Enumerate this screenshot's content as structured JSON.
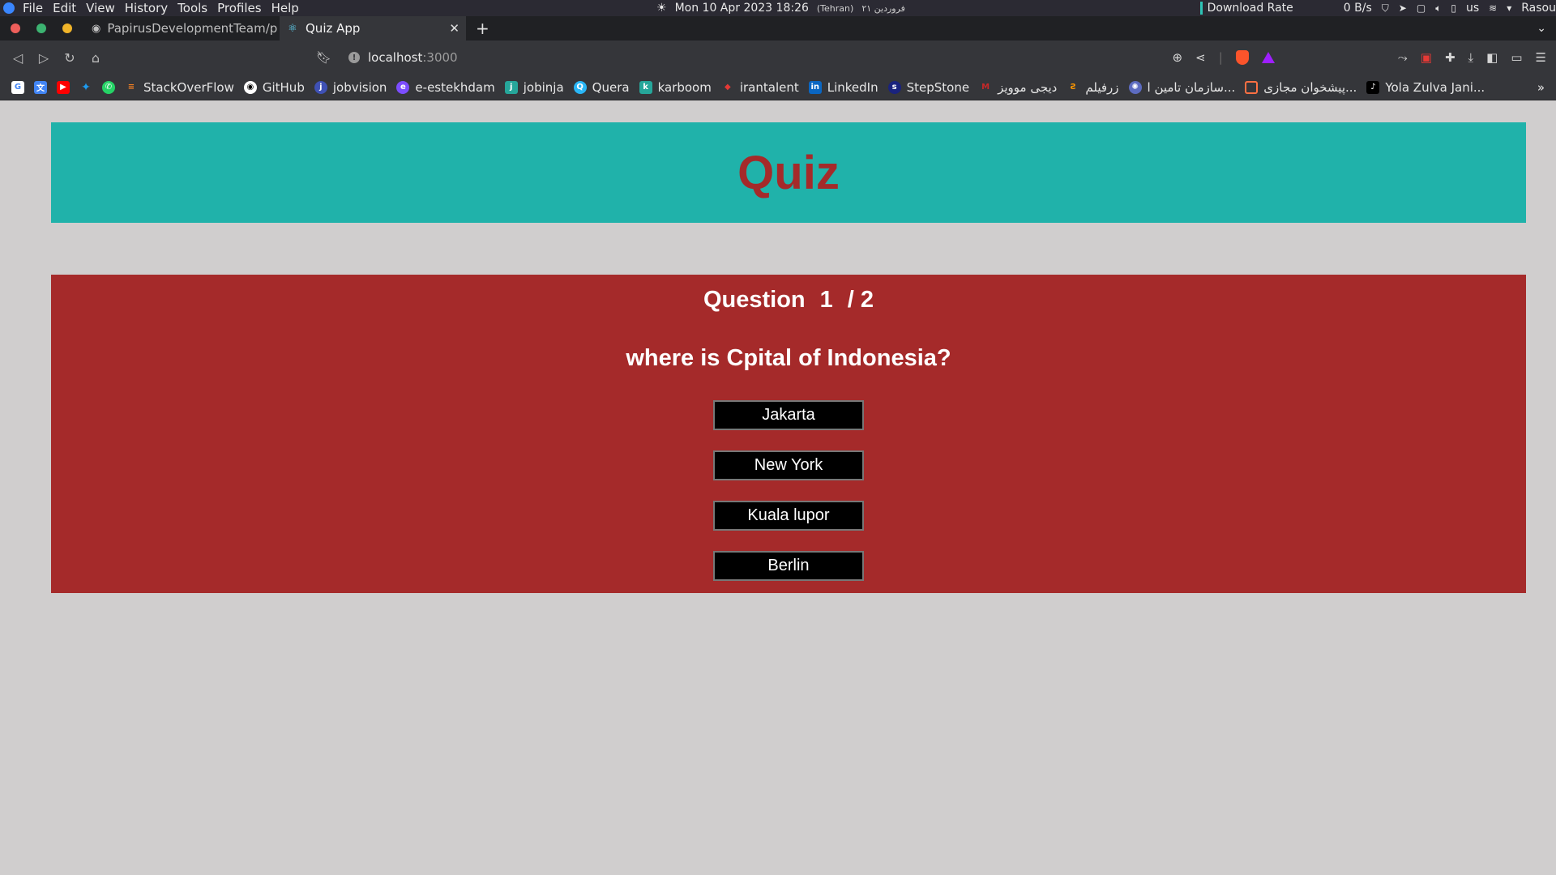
{
  "os": {
    "menu": [
      "File",
      "Edit",
      "View",
      "History",
      "Tools",
      "Profiles",
      "Help"
    ],
    "datetime": "Mon 10 Apr 2023  18:26",
    "tz": "(Tehran)",
    "persian_date": "۲۱ فروردین",
    "download_label": "Download Rate",
    "download_value": "0 B/s",
    "keyboard": "us",
    "user": "Rasou"
  },
  "tabs": [
    {
      "title": "PapirusDevelopmentTeam/p",
      "icon": "github-icon"
    },
    {
      "title": "Quiz App",
      "icon": "react-icon"
    }
  ],
  "toolbar": {
    "url_host": "localhost",
    "url_port": ":3000"
  },
  "bookmarks": [
    {
      "label": "",
      "icon": "google-icon",
      "color": "#ffffff"
    },
    {
      "label": "",
      "icon": "translate-icon",
      "color": "#4285f4"
    },
    {
      "label": "",
      "icon": "youtube-icon",
      "color": "#ff0000"
    },
    {
      "label": "",
      "icon": "twitter-icon",
      "color": "#1d9bf0"
    },
    {
      "label": "",
      "icon": "whatsapp-icon",
      "color": "#25d366"
    },
    {
      "label": "StackOverFlow",
      "icon": "stackoverflow-icon",
      "color": "#f48024"
    },
    {
      "label": "GitHub",
      "icon": "github-icon",
      "color": "#ffffff"
    },
    {
      "label": "jobvision",
      "icon": "jobvision-icon",
      "color": "#3f51b5"
    },
    {
      "label": "e-estekhdam",
      "icon": "e-estekhdam-icon",
      "color": "#7c4dff"
    },
    {
      "label": "jobinja",
      "icon": "jobinja-icon",
      "color": "#26a69a"
    },
    {
      "label": "Quera",
      "icon": "quera-icon",
      "color": "#29b6f6"
    },
    {
      "label": "karboom",
      "icon": "karboom-icon",
      "color": "#26a69a"
    },
    {
      "label": "irantalent",
      "icon": "irantalent-icon",
      "color": "#e53935"
    },
    {
      "label": "LinkedIn",
      "icon": "linkedin-icon",
      "color": "#0a66c2"
    },
    {
      "label": "StepStone",
      "icon": "stepstone-icon",
      "color": "#1a237e"
    },
    {
      "label": "دیجی موویز",
      "icon": "digimovies-icon",
      "color": "#c62828"
    },
    {
      "label": "زرفیلم",
      "icon": "zarfilm-icon",
      "color": "#ff9800"
    },
    {
      "label": "سازمان تامین ا...",
      "icon": "tamin-icon",
      "color": "#5c6bc0"
    },
    {
      "label": "پیشخوان مجازی...",
      "icon": "pishkhan-icon",
      "color": "#ff7043"
    },
    {
      "label": "Yola Zulva Jani...",
      "icon": "tiktok-icon",
      "color": "#000000"
    }
  ],
  "quiz": {
    "title": "Quiz",
    "question_label": "Question",
    "current": "1",
    "total": "/ 2",
    "question": "where is Cpital of Indonesia?",
    "answers": [
      "Jakarta",
      "New York",
      "Kuala lupor",
      "Berlin"
    ]
  },
  "colors": {
    "page_bg": "#d0cece",
    "header_bg": "#20b2aa",
    "title_color": "#a52a2a",
    "card_bg": "#a52a2a",
    "answer_bg": "#000000"
  }
}
